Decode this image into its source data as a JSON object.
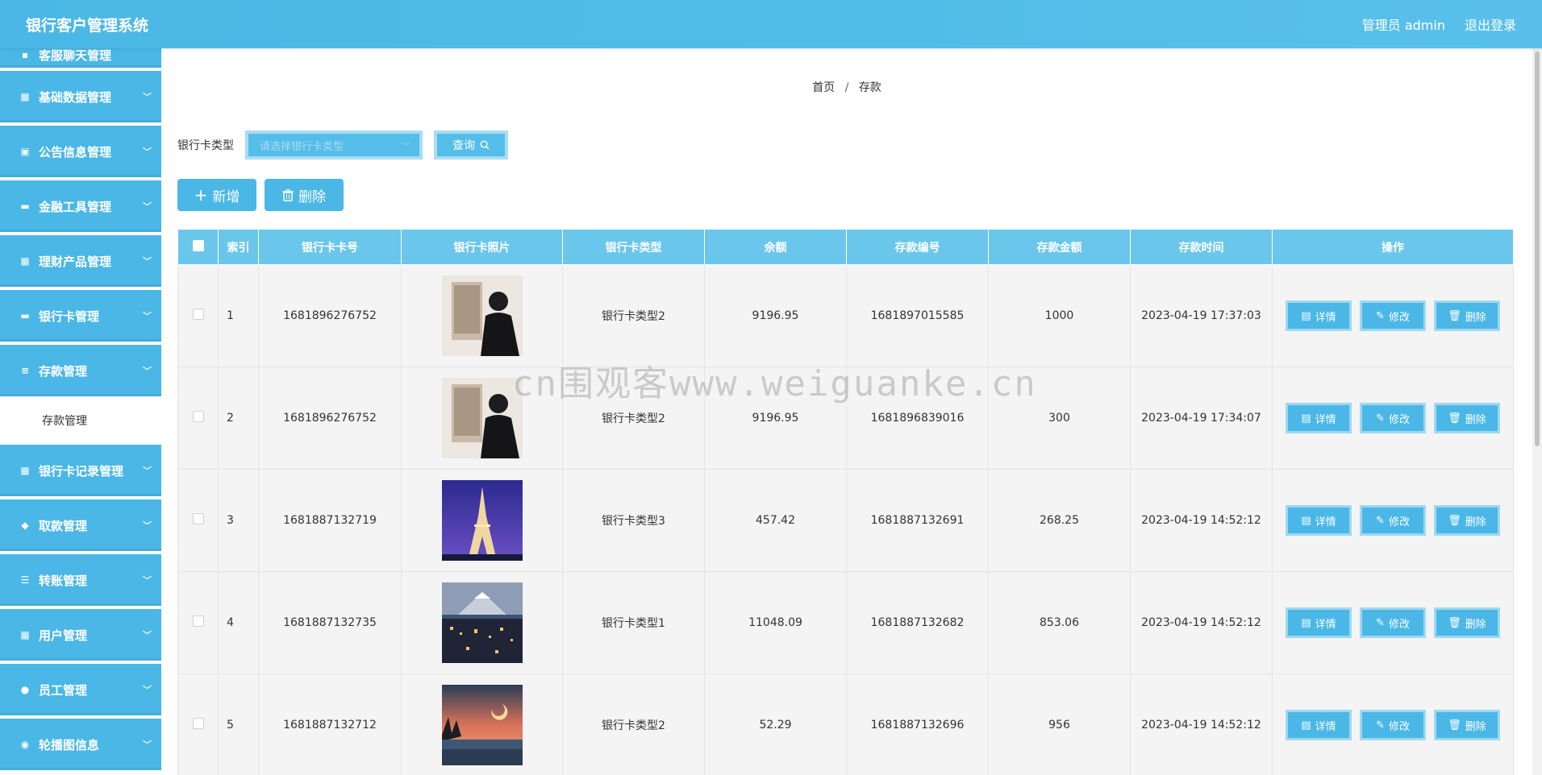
{
  "header": {
    "title": "银行客户管理系统",
    "user": "管理员 admin",
    "logout": "退出登录"
  },
  "sidebar": {
    "items": [
      {
        "label": "客服聊天管理",
        "icon": "chat-icon"
      },
      {
        "label": "基础数据管理",
        "icon": "grid-icon"
      },
      {
        "label": "公告信息管理",
        "icon": "clipboard-icon"
      },
      {
        "label": "金融工具管理",
        "icon": "card-icon"
      },
      {
        "label": "理财产品管理",
        "icon": "grid-icon"
      },
      {
        "label": "银行卡管理",
        "icon": "bankcard-icon"
      },
      {
        "label": "存款管理",
        "icon": "list-icon"
      },
      {
        "label": "银行卡记录管理",
        "icon": "grid-icon"
      },
      {
        "label": "取款管理",
        "icon": "hand-icon"
      },
      {
        "label": "转账管理",
        "icon": "sliders-icon"
      },
      {
        "label": "用户管理",
        "icon": "grid-icon"
      },
      {
        "label": "员工管理",
        "icon": "user-icon"
      },
      {
        "label": "轮播图信息",
        "icon": "pin-icon"
      }
    ],
    "submenu": "存款管理"
  },
  "breadcrumb": {
    "home": "首页",
    "sep": "/",
    "current": "存款"
  },
  "search": {
    "label": "银行卡类型",
    "placeholder": "请选择银行卡类型",
    "button": "查询"
  },
  "actions": {
    "add": "新增",
    "delete": "删除"
  },
  "table": {
    "headers": [
      "索引",
      "银行卡卡号",
      "银行卡照片",
      "银行卡类型",
      "余额",
      "存款编号",
      "存款金额",
      "存款时间",
      "操作"
    ],
    "rows": [
      {
        "index": "1",
        "card_no": "1681896276752",
        "photo": "portrait-photo",
        "type": "银行卡类型2",
        "balance": "9196.95",
        "deposit_no": "1681897015585",
        "amount": "1000",
        "time": "2023-04-19 17:37:03"
      },
      {
        "index": "2",
        "card_no": "1681896276752",
        "photo": "portrait-photo",
        "type": "银行卡类型2",
        "balance": "9196.95",
        "deposit_no": "1681896839016",
        "amount": "300",
        "time": "2023-04-19 17:34:07"
      },
      {
        "index": "3",
        "card_no": "1681887132719",
        "photo": "eiffel-tower-photo",
        "type": "银行卡类型3",
        "balance": "457.42",
        "deposit_no": "1681887132691",
        "amount": "268.25",
        "time": "2023-04-19 14:52:12"
      },
      {
        "index": "4",
        "card_no": "1681887132735",
        "photo": "mountain-city-photo",
        "type": "银行卡类型1",
        "balance": "11048.09",
        "deposit_no": "1681887132682",
        "amount": "853.06",
        "time": "2023-04-19 14:52:12"
      },
      {
        "index": "5",
        "card_no": "1681887132712",
        "photo": "sunset-lake-photo",
        "type": "银行卡类型2",
        "balance": "52.29",
        "deposit_no": "1681887132696",
        "amount": "956",
        "time": "2023-04-19 14:52:12"
      }
    ],
    "ops": {
      "detail": "详情",
      "edit": "修改",
      "delete": "删除"
    }
  },
  "watermark": "cn围观客www.weiguanke.cn"
}
